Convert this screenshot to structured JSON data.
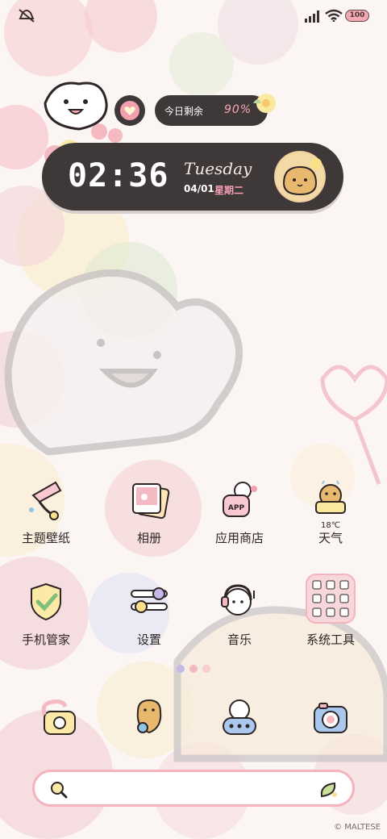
{
  "status_bar": {
    "battery": "100"
  },
  "widgets": {
    "remaining_label": "今日剩余",
    "remaining_percent": "90%",
    "time": "02:36",
    "weekday": "Tuesday",
    "date": "04/01",
    "weekday_cn": "星期二"
  },
  "apps": [
    {
      "label": "主题壁纸",
      "icon": "theme-wallpaper-icon"
    },
    {
      "label": "相册",
      "icon": "photo-album-icon"
    },
    {
      "label": "应用商店",
      "icon": "app-store-icon"
    },
    {
      "label": "天气",
      "icon": "weather-icon",
      "temp": "18℃"
    },
    {
      "label": "手机管家",
      "icon": "phone-manager-icon"
    },
    {
      "label": "设置",
      "icon": "settings-icon"
    },
    {
      "label": "音乐",
      "icon": "music-icon"
    },
    {
      "label": "系统工具",
      "icon": "system-tools-folder-icon"
    }
  ],
  "dock": [
    {
      "icon": "phone-icon"
    },
    {
      "icon": "contacts-icon"
    },
    {
      "icon": "messages-icon"
    },
    {
      "icon": "camera-icon"
    }
  ],
  "search": {
    "icon": "search-icon",
    "right_icon": "assistant-leaf-icon"
  },
  "footer": {
    "copyright": "© MALTESE"
  },
  "colors": {
    "dark": "#3f3838",
    "pink": "#f4b3bd",
    "accent_pink": "#f5a0b5"
  }
}
